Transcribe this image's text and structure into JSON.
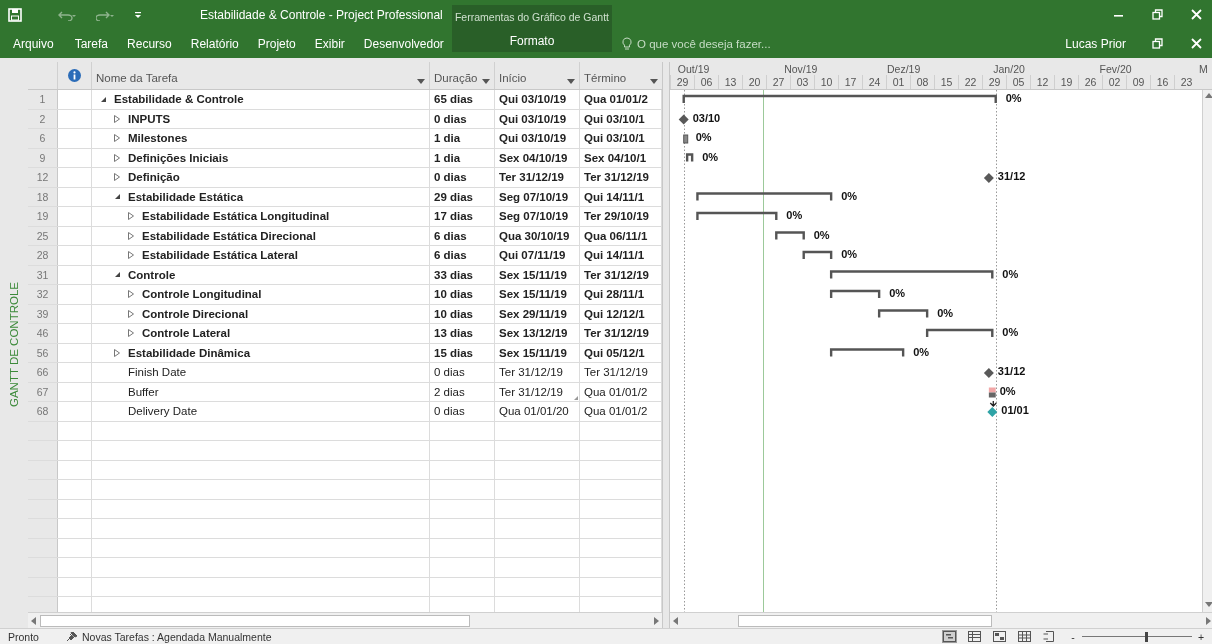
{
  "window": {
    "title": "Estabilidade & Controle - Project Professional",
    "contextual_title": "Ferramentas do Gráfico de Gantt",
    "user": "Lucas Prior"
  },
  "ribbon_tabs": [
    {
      "label": "Arquivo",
      "selected": false,
      "kind": "file"
    },
    {
      "label": "Tarefa",
      "selected": false,
      "kind": "main"
    },
    {
      "label": "Recurso",
      "selected": false,
      "kind": "main"
    },
    {
      "label": "Relatório",
      "selected": false,
      "kind": "main"
    },
    {
      "label": "Projeto",
      "selected": false,
      "kind": "main"
    },
    {
      "label": "Exibir",
      "selected": false,
      "kind": "main"
    },
    {
      "label": "Desenvolvedor",
      "selected": false,
      "kind": "main"
    },
    {
      "label": "Formato",
      "selected": false,
      "kind": "contextual"
    }
  ],
  "tell_me": {
    "placeholder": "O que você deseja fazer..."
  },
  "side_label": "GANTT DE CONTROLE",
  "columns": [
    "Nome da Tarefa",
    "Duração",
    "Início",
    "Término"
  ],
  "timescale": {
    "months": [
      "Out/19",
      "Nov/19",
      "Dez/19",
      "Jan/20",
      "Fev/20",
      "M"
    ],
    "weeks": [
      "29",
      "06",
      "13",
      "20",
      "27",
      "03",
      "10",
      "17",
      "24",
      "01",
      "08",
      "15",
      "22",
      "29",
      "05",
      "12",
      "19",
      "26",
      "02",
      "09",
      "16",
      "23"
    ]
  },
  "tasks": [
    {
      "id": "1",
      "name": "Estabilidade & Controle",
      "kind": "summary",
      "expanded": true,
      "duration": "65 dias",
      "start": "Qui 03/10/19",
      "finish": "Qua 01/01/2",
      "bar": {
        "kind": "summary",
        "label": "0%"
      },
      "children": [
        {
          "id": "2",
          "name": "INPUTS",
          "kind": "summary",
          "expanded": false,
          "duration": "0 dias",
          "start": "Qui 03/10/19",
          "finish": "Qui 03/10/1",
          "bar": {
            "kind": "milestone",
            "label": "03/10",
            "color": "#595959"
          }
        },
        {
          "id": "6",
          "name": "Milestones",
          "kind": "summary",
          "expanded": false,
          "duration": "1 dia",
          "start": "Qui 03/10/19",
          "finish": "Qui 03/10/1",
          "bar": {
            "kind": "rollup",
            "label": "0%"
          }
        },
        {
          "id": "9",
          "name": "Definições Iniciais",
          "kind": "summary",
          "expanded": false,
          "duration": "1 dia",
          "start": "Sex 04/10/19",
          "finish": "Sex 04/10/1",
          "bar": {
            "kind": "summary",
            "label": "0%"
          }
        },
        {
          "id": "12",
          "name": "Definição",
          "kind": "summary",
          "expanded": false,
          "duration": "0 dias",
          "start": "Ter 31/12/19",
          "finish": "Ter 31/12/19",
          "bar": {
            "kind": "milestone",
            "label": "31/12",
            "color": "#595959"
          }
        },
        {
          "id": "18",
          "name": "Estabilidade Estática",
          "kind": "summary",
          "expanded": true,
          "duration": "29 dias",
          "start": "Seg 07/10/19",
          "finish": "Qui 14/11/1",
          "bar": {
            "kind": "summary",
            "label": "0%"
          },
          "children": [
            {
              "id": "19",
              "name": "Estabilidade Estática Longitudinal",
              "kind": "summary",
              "expanded": false,
              "duration": "17 dias",
              "start": "Seg 07/10/19",
              "finish": "Ter 29/10/19",
              "bar": {
                "kind": "summary",
                "label": "0%"
              }
            },
            {
              "id": "25",
              "name": "Estabilidade Estática Direcional",
              "kind": "summary",
              "expanded": false,
              "duration": "6 dias",
              "start": "Qua 30/10/19",
              "finish": "Qua 06/11/1",
              "bar": {
                "kind": "summary",
                "label": "0%"
              }
            },
            {
              "id": "28",
              "name": "Estabilidade Estática Lateral",
              "kind": "summary",
              "expanded": false,
              "duration": "6 dias",
              "start": "Qui 07/11/19",
              "finish": "Qui 14/11/1",
              "bar": {
                "kind": "summary",
                "label": "0%"
              }
            }
          ]
        },
        {
          "id": "31",
          "name": "Controle",
          "kind": "summary",
          "expanded": true,
          "duration": "33 dias",
          "start": "Sex 15/11/19",
          "finish": "Ter 31/12/19",
          "bar": {
            "kind": "summary",
            "label": "0%"
          },
          "children": [
            {
              "id": "32",
              "name": "Controle Longitudinal",
              "kind": "summary",
              "expanded": false,
              "duration": "10 dias",
              "start": "Sex 15/11/19",
              "finish": "Qui 28/11/1",
              "bar": {
                "kind": "summary",
                "label": "0%"
              }
            },
            {
              "id": "39",
              "name": "Controle Direcional",
              "kind": "summary",
              "expanded": false,
              "duration": "10 dias",
              "start": "Sex 29/11/19",
              "finish": "Qui 12/12/1",
              "bar": {
                "kind": "summary",
                "label": "0%"
              }
            },
            {
              "id": "46",
              "name": "Controle Lateral",
              "kind": "summary",
              "expanded": false,
              "duration": "13 dias",
              "start": "Sex 13/12/19",
              "finish": "Ter 31/12/19",
              "bar": {
                "kind": "summary",
                "label": "0%"
              }
            }
          ]
        },
        {
          "id": "56",
          "name": "Estabilidade Dinâmica",
          "kind": "summary",
          "expanded": false,
          "duration": "15 dias",
          "start": "Sex 15/11/19",
          "finish": "Qui 05/12/1",
          "bar": {
            "kind": "summary",
            "label": "0%"
          }
        },
        {
          "id": "66",
          "name": "Finish Date",
          "kind": "task",
          "duration": "0 dias",
          "start": "Ter 31/12/19",
          "finish": "Ter 31/12/19",
          "bar": {
            "kind": "milestone",
            "label": "31/12",
            "color": "#595959"
          }
        },
        {
          "id": "67",
          "name": "Buffer",
          "kind": "task",
          "duration": "2 dias",
          "start": "Ter 31/12/19",
          "start_marked": true,
          "finish": "Qua 01/01/2",
          "bar": {
            "kind": "task",
            "label": "0%"
          }
        },
        {
          "id": "68",
          "name": "Delivery Date",
          "kind": "task",
          "duration": "0 dias",
          "start": "Qua 01/01/20",
          "finish": "Qua 01/01/2",
          "bar": {
            "kind": "milestone",
            "label": "01/01",
            "color": "#2fa3a6",
            "deadline": true
          }
        }
      ]
    }
  ],
  "status_bar": {
    "state": "Pronto",
    "new_tasks": "Novas Tarefas : Agendada Manualmente",
    "zoom_minus": "-",
    "zoom_plus": "+",
    "zoom": {
      "level": 0.58
    }
  }
}
